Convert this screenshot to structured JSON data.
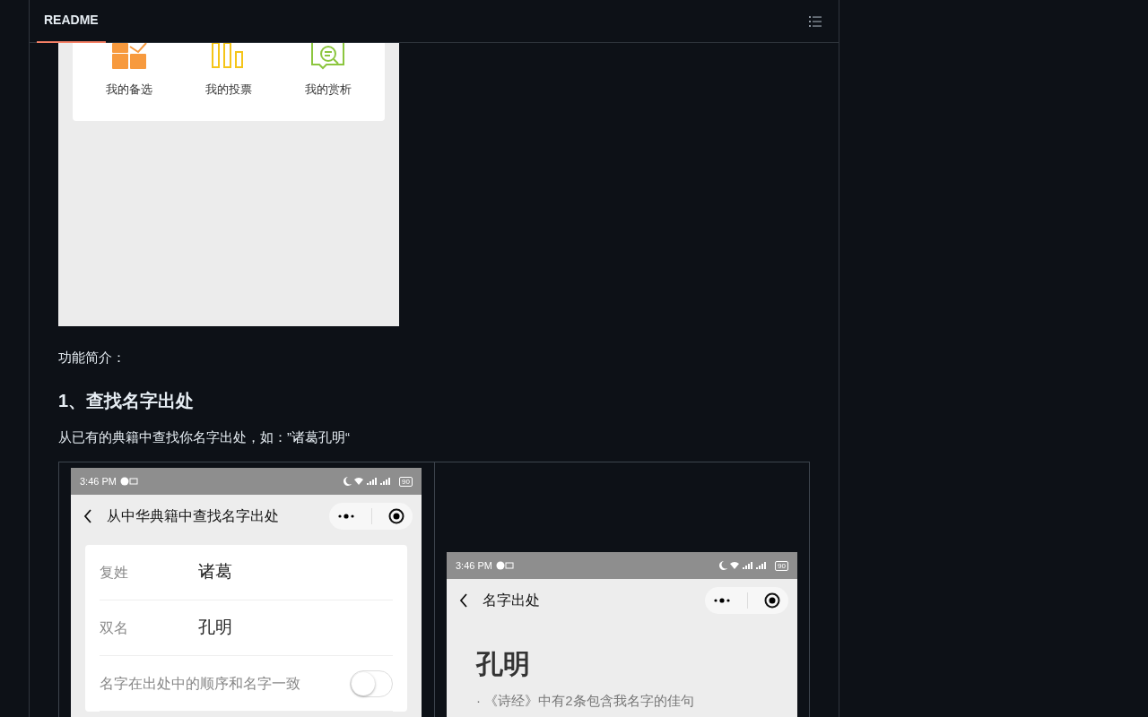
{
  "readme": {
    "tab": {
      "label": "README",
      "selected": true
    }
  },
  "top_image": {
    "shortcuts": [
      {
        "label": "我的备选",
        "kind": "grid"
      },
      {
        "label": "我的投票",
        "kind": "bars"
      },
      {
        "label": "我的赏析",
        "kind": "comment"
      }
    ]
  },
  "intro": "功能简介：",
  "heading": "1、查找名字出处",
  "paragraph": "从已有的典籍中查找你名字出处，如：”诸葛孔明“",
  "screens": [
    {
      "kind": "form",
      "time": "3:46 PM",
      "battery": "90",
      "title": "从中华典籍中查找名字出处",
      "fields": [
        {
          "label": "复姓",
          "value": "诸葛"
        },
        {
          "label": "双名",
          "value": "孔明"
        }
      ],
      "toggle": {
        "label": "名字在出处中的顺序和名字一致",
        "on": false
      }
    },
    {
      "kind": "result",
      "time": "3:46 PM",
      "battery": "90",
      "title": "名字出处",
      "name": "孔明",
      "summary": "· 《诗经》中有2条包含我名字的佳句"
    }
  ]
}
